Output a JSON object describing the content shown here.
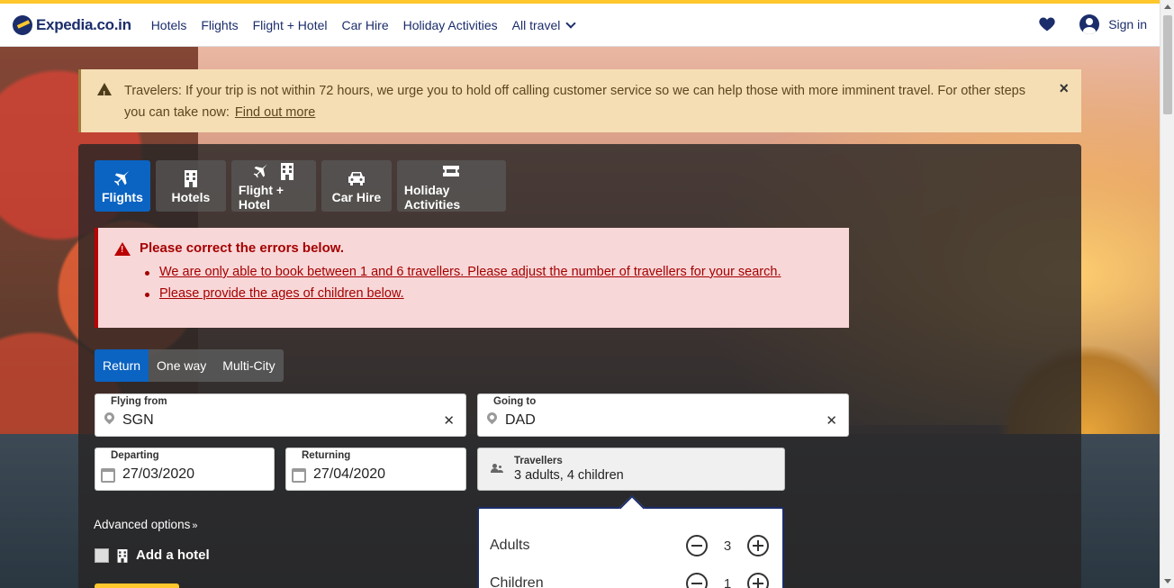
{
  "header": {
    "logo_text": "Expedia.co.in",
    "nav": [
      "Hotels",
      "Flights",
      "Flight + Hotel",
      "Car Hire",
      "Holiday Activities"
    ],
    "all_travel": "All travel",
    "sign_in": "Sign in"
  },
  "alert": {
    "text": "Travelers: If your trip is not within 72 hours, we urge you to hold off calling customer service so we can help those with more imminent travel. For other steps you can take now:",
    "link": "Find out more",
    "close": "×"
  },
  "tabs": [
    {
      "label": "Flights",
      "active": true
    },
    {
      "label": "Hotels"
    },
    {
      "label": "Flight + Hotel"
    },
    {
      "label": "Car Hire"
    },
    {
      "label": "Holiday Activities"
    }
  ],
  "error": {
    "title": "Please correct the errors below.",
    "items": [
      "We are only able to book between 1 and 6 travellers. Please adjust the number of travellers for your search.",
      "Please provide the ages of children below."
    ]
  },
  "trip_type": {
    "options": [
      "Return",
      "One way",
      "Multi-City"
    ],
    "selected": "Return"
  },
  "flying_from": {
    "label": "Flying from",
    "value": "SGN"
  },
  "going_to": {
    "label": "Going to",
    "value": "DAD"
  },
  "departing": {
    "label": "Departing",
    "value": "27/03/2020"
  },
  "returning": {
    "label": "Returning",
    "value": "27/04/2020"
  },
  "travellers": {
    "label": "Travellers",
    "value": "3 adults, 4 children"
  },
  "advanced_options": "Advanced options",
  "add_hotel": "Add a hotel",
  "popup": {
    "adults_label": "Adults",
    "adults_count": "3",
    "children_label": "Children",
    "children_count": "1"
  },
  "colors": {
    "brand_yellow": "#ffc72c",
    "brand_navy": "#1b2d6b",
    "active_blue": "#0b63c2",
    "error_red": "#a40000"
  }
}
